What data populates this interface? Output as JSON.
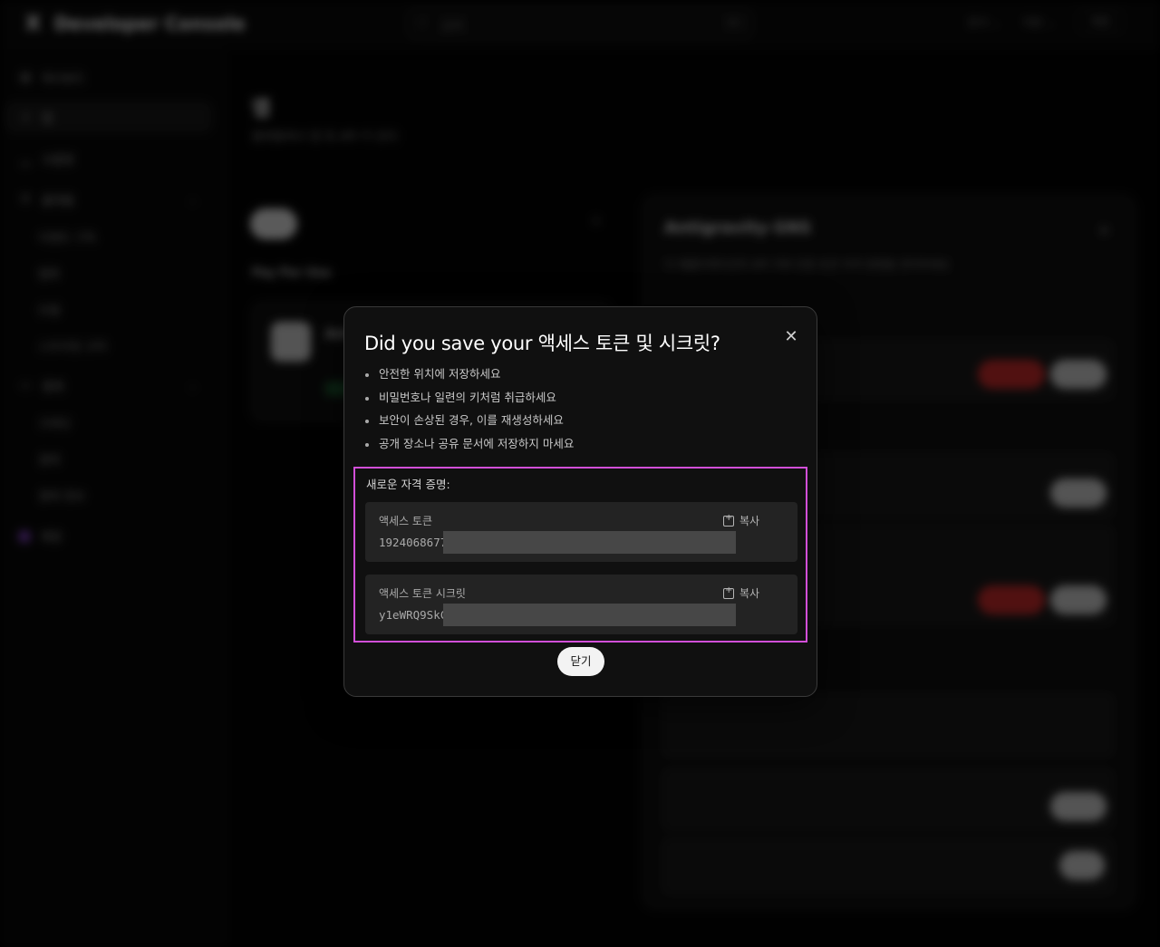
{
  "topbar": {
    "logo_mark": "X",
    "logo_text": "Developer Console",
    "search_placeholder": "검색",
    "search_shortcut": "⌘K",
    "menu_docs": "문서 ⌄",
    "menu_support": "지원 ⌄",
    "account_label": "계정"
  },
  "sidebar": {
    "items": [
      {
        "label": "대시보드"
      },
      {
        "label": "앱"
      },
      {
        "label": "사용량"
      },
      {
        "label": "플랫폼"
      },
      {
        "label": "이벤트 구독"
      },
      {
        "label": "웹훅"
      },
      {
        "label": "모델"
      },
      {
        "label": "스트리밍 규칙"
      },
      {
        "label": "결제"
      },
      {
        "label": "크레딧"
      },
      {
        "label": "결제"
      },
      {
        "label": "결제 정보"
      },
      {
        "label": "계정"
      }
    ]
  },
  "main": {
    "title": "앱",
    "subtitle": "플랫폼에서 앱 및 API 키 관리",
    "plan_label": "Pay Per Use",
    "app_card_title": "Ant"
  },
  "panel": {
    "title": "Antigravity-SNS",
    "description": "이 애플리케이션의 API 키와 인증 토큰 자격 증명을 관리하세요"
  },
  "modal": {
    "title": "Did you save your 액세스 토큰 및 시크릿?",
    "bullets": [
      "안전한 위치에 저장하세요",
      "비밀번호나 일련의 키처럼 취급하세요",
      "보안이 손상된 경우, 이를 재생성하세요",
      "공개 장소나 공유 문서에 저장하지 마세요"
    ],
    "credentials_heading": "새로운 자격 증명:",
    "access_token": {
      "label": "액세스 토큰",
      "value": "1924068677",
      "copy_label": "복사"
    },
    "access_token_secret": {
      "label": "액세스 토큰 시크릿",
      "value": "y1eWRQ9SkC",
      "copy_label": "복사"
    },
    "close_label": "닫기"
  },
  "colors": {
    "highlight_border": "#d24fd8",
    "close_button_bg": "#f3f3f3",
    "modal_bg": "#101010"
  }
}
